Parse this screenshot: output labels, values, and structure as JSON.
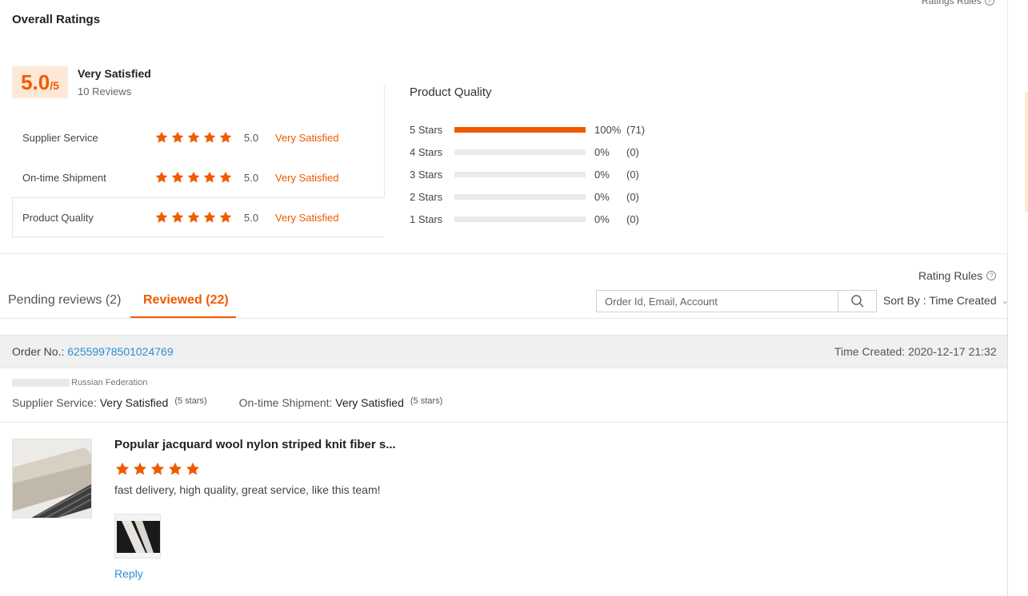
{
  "summary": {
    "section_title": "Overall Ratings",
    "ratings_rules": "Ratings Rules",
    "score": "5.0",
    "score_max": "/5",
    "overall_label": "Very Satisfied",
    "review_count": "10 Reviews",
    "rows": [
      {
        "label": "Supplier Service",
        "stars": 5,
        "score": "5.0",
        "text": "Very Satisfied"
      },
      {
        "label": "On-time Shipment",
        "stars": 5,
        "score": "5.0",
        "text": "Very Satisfied"
      },
      {
        "label": "Product Quality",
        "stars": 5,
        "score": "5.0",
        "text": "Very Satisfied"
      }
    ]
  },
  "product_quality": {
    "title": "Product Quality",
    "distribution": [
      {
        "label": "5  Stars",
        "fraction": 1.0,
        "pct": "100%",
        "count": "(71)"
      },
      {
        "label": "4  Stars",
        "fraction": 0,
        "pct": "0%",
        "count": "(0)"
      },
      {
        "label": "3  Stars",
        "fraction": 0,
        "pct": "0%",
        "count": "(0)"
      },
      {
        "label": "2  Stars",
        "fraction": 0,
        "pct": "0%",
        "count": "(0)"
      },
      {
        "label": "1  Stars",
        "fraction": 0,
        "pct": "0%",
        "count": "(0)"
      }
    ]
  },
  "toolbar": {
    "rating_rules": "Rating Rules",
    "tab_pending": "Pending reviews (2)",
    "tab_reviewed": "Reviewed (22)",
    "search_placeholder": "Order Id, Email, Account",
    "sort_by": "Sort By : Time Created"
  },
  "order": {
    "order_no_label": "Order No.:",
    "order_no": "62559978501024769",
    "time_created": "Time Created: 2020-12-17 21:32",
    "buyer_country": "Russian Federation",
    "supplier_service_label": "Supplier Service:",
    "supplier_service_value": "Very Satisfied",
    "supplier_service_stars": "(5 stars)",
    "shipment_label": "On-time Shipment:",
    "shipment_value": "Very Satisfied",
    "shipment_stars": "(5 stars)",
    "product_title": "Popular jacquard wool nylon striped knit fiber s...",
    "review_stars": 5,
    "review_text": "fast delivery, high quality, great service, like this team!",
    "reply": "Reply"
  },
  "colors": {
    "accent": "#f05a00",
    "link": "#2a8fd6",
    "score_bg": "#fde7d7"
  }
}
